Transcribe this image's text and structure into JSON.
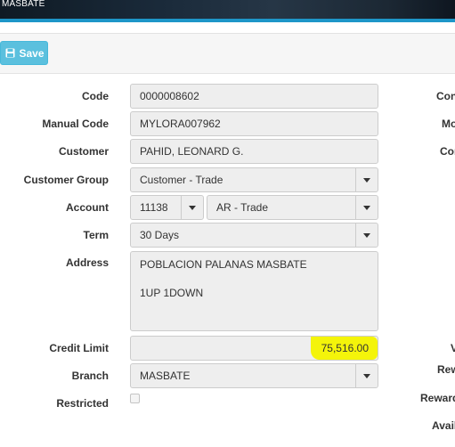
{
  "topbar": {
    "title": "MASBATE"
  },
  "toolbar": {
    "save_label": "Save",
    "save_icon": "floppy-disk-icon"
  },
  "form": {
    "code": {
      "label": "Code",
      "value": "0000008602"
    },
    "manual_code": {
      "label": "Manual Code",
      "value": "MYLORA007962"
    },
    "customer": {
      "label": "Customer",
      "value": "PAHID, LEONARD G."
    },
    "customer_group": {
      "label": "Customer Group",
      "value": "Customer - Trade"
    },
    "account": {
      "label": "Account",
      "code_value": "11138",
      "name_value": "AR - Trade"
    },
    "term": {
      "label": "Term",
      "value": "30 Days"
    },
    "address": {
      "label": "Address",
      "line1": "POBLACION PALANAS MASBATE",
      "line2": "1UP 1DOWN"
    },
    "credit_limit": {
      "label": "Credit Limit",
      "value": "75,516.00",
      "highlight_color": "#f4f40a"
    },
    "branch": {
      "label": "Branch",
      "value": "MASBATE"
    },
    "restricted": {
      "label": "Restricted",
      "checked": false
    }
  },
  "right_column": {
    "labels": [
      "Con",
      "Mo",
      "Cor",
      "V",
      "Rew",
      "Reward",
      "Avail"
    ]
  },
  "colors": {
    "accent": "#1e96c8",
    "save_button": "#5bc0de"
  }
}
